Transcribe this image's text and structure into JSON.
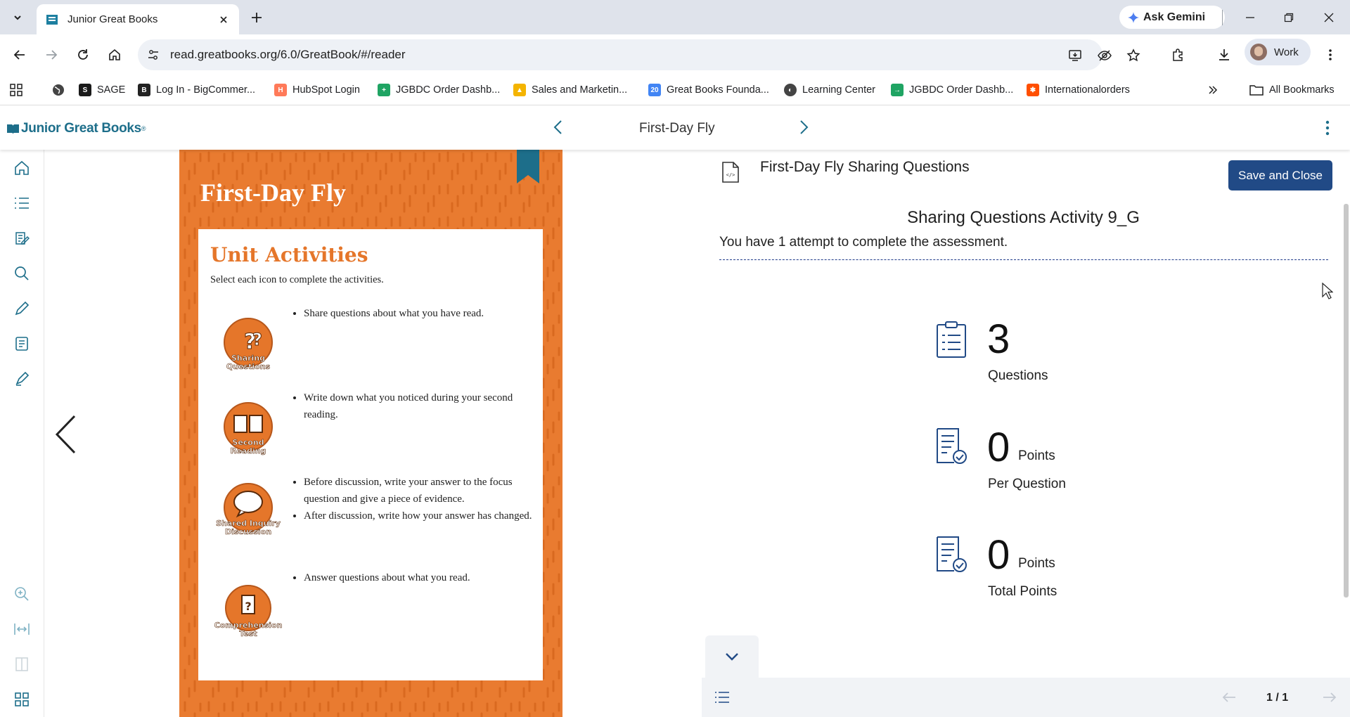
{
  "browser": {
    "tab_title": "Junior Great Books",
    "gemini_label": "Ask Gemini",
    "url": "read.greatbooks.org/6.0/GreatBook/#/reader",
    "profile_label": "Work",
    "bookmarks": [
      {
        "label": "SAGE",
        "icon": "sage-icon"
      },
      {
        "label": "Log In - BigCommer...",
        "icon": "bigcommerce-icon"
      },
      {
        "label": "HubSpot Login",
        "icon": "hubspot-icon"
      },
      {
        "label": "JGBDC Order Dashb...",
        "icon": "sheets-icon"
      },
      {
        "label": "Sales and Marketin...",
        "icon": "drive-icon"
      },
      {
        "label": "Great Books Founda...",
        "icon": "calendar-icon"
      },
      {
        "label": "Learning Center",
        "icon": "globe-icon"
      },
      {
        "label": "JGBDC Order Dashb...",
        "icon": "green-arrow-icon"
      },
      {
        "label": "Internationalorders",
        "icon": "zapier-icon"
      }
    ],
    "all_bookmarks_label": "All Bookmarks"
  },
  "app": {
    "logo_text": "Junior Great Books",
    "logo_reg": "®",
    "book_title": "First-Day Fly"
  },
  "page": {
    "title": "First-Day Fly",
    "heading": "Unit Activities",
    "subheading": "Select each icon to complete the activities.",
    "activities": [
      {
        "icon_label": "Sharing Questions",
        "bullets": [
          "Share questions about what you have read."
        ]
      },
      {
        "icon_label": "Second Reading",
        "bullets": [
          "Write down what you noticed during your second reading."
        ]
      },
      {
        "icon_label": "Shared Inquiry Discussion",
        "bullets": [
          "Before discussion, write your answer to the focus question and give a piece of evidence.",
          "After discussion, write how your answer has changed."
        ]
      },
      {
        "icon_label": "Comprehension Test",
        "bullets": [
          "Answer questions about what you read."
        ]
      }
    ]
  },
  "panel": {
    "title": "First-Day Fly Sharing Questions",
    "save_close_label": "Save and Close",
    "activity_title": "Sharing Questions Activity 9_G",
    "attempt_text": "You have 1 attempt to complete the assessment.",
    "stats": [
      {
        "value": "3",
        "unit": "",
        "label": "Questions"
      },
      {
        "value": "0",
        "unit": "Points",
        "label": "Per Question"
      },
      {
        "value": "0",
        "unit": "Points",
        "label": "Total Points"
      }
    ],
    "pager": "1 / 1"
  },
  "colors": {
    "brand": "#1d6e8a",
    "page_orange": "#e97b30",
    "button_navy": "#214a86"
  }
}
